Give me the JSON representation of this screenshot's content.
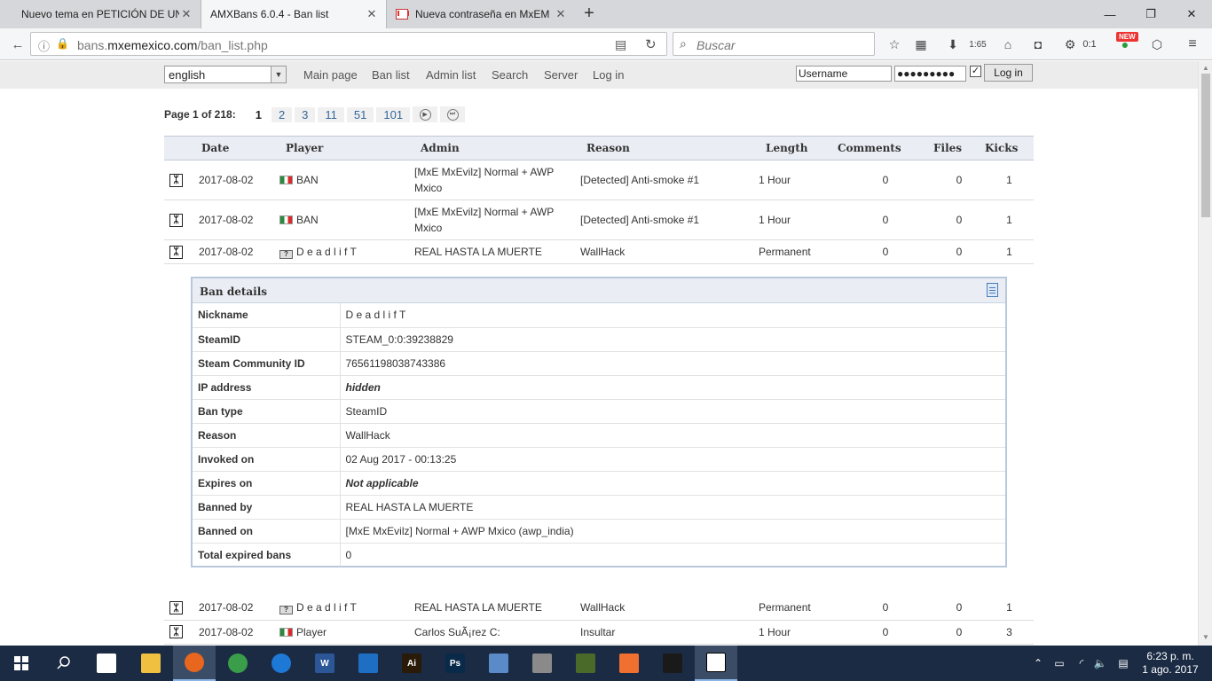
{
  "browser": {
    "tabs": [
      {
        "title": "Nuevo tema en PETICIÓN DE UN"
      },
      {
        "title": "AMXBans 6.0.4 - Ban list"
      },
      {
        "title": "Nueva contraseña en MxEM"
      }
    ],
    "url": {
      "prefix": "bans.",
      "domain": "mxemexico.com",
      "path": "/ban_list.php"
    },
    "search_placeholder": "Buscar",
    "download_count": "1:65",
    "extension_count": "0:1",
    "new_badge": "NEW"
  },
  "site": {
    "language": "english",
    "menu": [
      "Main page",
      "Ban list",
      "Admin list",
      "Search",
      "Server",
      "Log in"
    ],
    "login": {
      "username": "Username",
      "password": "●●●●●●●●●",
      "checkbox": "✓",
      "button": "Log in"
    }
  },
  "pagination": {
    "label": "Page 1 of 218:",
    "current": "1",
    "pages": [
      "2",
      "3",
      "11",
      "51",
      "101"
    ]
  },
  "table": {
    "headers": [
      "Date",
      "Player",
      "Admin",
      "Reason",
      "Length",
      "Comments",
      "Files",
      "Kicks"
    ],
    "rows": [
      {
        "date": "2017-08-02",
        "player": "BAN",
        "admin": "[MxE MxEvilz] Normal + AWP Mxico",
        "reason": "[Detected] Anti-smoke #1",
        "length": "1 Hour",
        "comments": "0",
        "files": "0",
        "kicks": "1"
      },
      {
        "date": "2017-08-02",
        "player": "BAN",
        "admin": "[MxE MxEvilz] Normal + AWP Mxico",
        "reason": "[Detected] Anti-smoke #1",
        "length": "1 Hour",
        "comments": "0",
        "files": "0",
        "kicks": "1"
      },
      {
        "date": "2017-08-02",
        "player": "D e a d l i f T",
        "admin": "REAL HASTA LA MUERTE",
        "reason": "WallHack",
        "length": "Permanent",
        "comments": "0",
        "files": "0",
        "kicks": "1"
      }
    ],
    "rows_after": [
      {
        "date": "2017-08-02",
        "player": "D e a d l i f T",
        "admin": "REAL HASTA LA MUERTE",
        "reason": "WallHack",
        "length": "Permanent",
        "comments": "0",
        "files": "0",
        "kicks": "1"
      },
      {
        "date": "2017-08-02",
        "player": "Player",
        "admin": "Carlos SuÃ¡rez C:",
        "reason": "Insultar",
        "length": "1 Hour",
        "comments": "0",
        "files": "0",
        "kicks": "3"
      }
    ]
  },
  "details": {
    "title": "Ban details",
    "rows": [
      {
        "key": "Nickname",
        "value": "D e a d l i f T"
      },
      {
        "key": "SteamID",
        "value": "STEAM_0:0:39238829"
      },
      {
        "key": "Steam Community ID",
        "value": "76561198038743386"
      },
      {
        "key": "IP address",
        "value": "hidden"
      },
      {
        "key": "Ban type",
        "value": "SteamID"
      },
      {
        "key": "Reason",
        "value": "WallHack"
      },
      {
        "key": "Invoked on",
        "value": "02 Aug 2017 - 00:13:25"
      },
      {
        "key": "Expires on",
        "value": "Not applicable"
      },
      {
        "key": "Banned by",
        "value": "REAL HASTA LA MUERTE"
      },
      {
        "key": "Banned on",
        "value": "[MxE MxEvilz] Normal + AWP Mxico (awp_india)"
      },
      {
        "key": "Total expired bans",
        "value": "0"
      }
    ]
  },
  "taskbar": {
    "apps": [
      {
        "name": "file-explorer",
        "color": "#f0c040",
        "label": ""
      },
      {
        "name": "firefox",
        "color": "#e8661e",
        "label": ""
      },
      {
        "name": "chrome",
        "color": "#3a9d4a",
        "label": ""
      },
      {
        "name": "edge",
        "color": "#1e78d6",
        "label": ""
      },
      {
        "name": "word",
        "color": "#2b5797",
        "label": "W"
      },
      {
        "name": "app-frame",
        "color": "#1e6fc4",
        "label": ""
      },
      {
        "name": "illustrator",
        "color": "#2a1a08",
        "label": "Ai"
      },
      {
        "name": "photoshop",
        "color": "#0a2a4a",
        "label": "Ps"
      },
      {
        "name": "virtualbox",
        "color": "#5a8ac8",
        "label": ""
      },
      {
        "name": "tools",
        "color": "#8a8a8a",
        "label": ""
      },
      {
        "name": "steam-game",
        "color": "#4a6a2a",
        "label": ""
      },
      {
        "name": "xampp",
        "color": "#f07030",
        "label": ""
      },
      {
        "name": "photos",
        "color": "#1a1a1a",
        "label": ""
      },
      {
        "name": "counter-strike",
        "color": "#ffffff",
        "label": ""
      }
    ],
    "time": "6:23 p. m.",
    "date": "1 ago. 2017"
  }
}
